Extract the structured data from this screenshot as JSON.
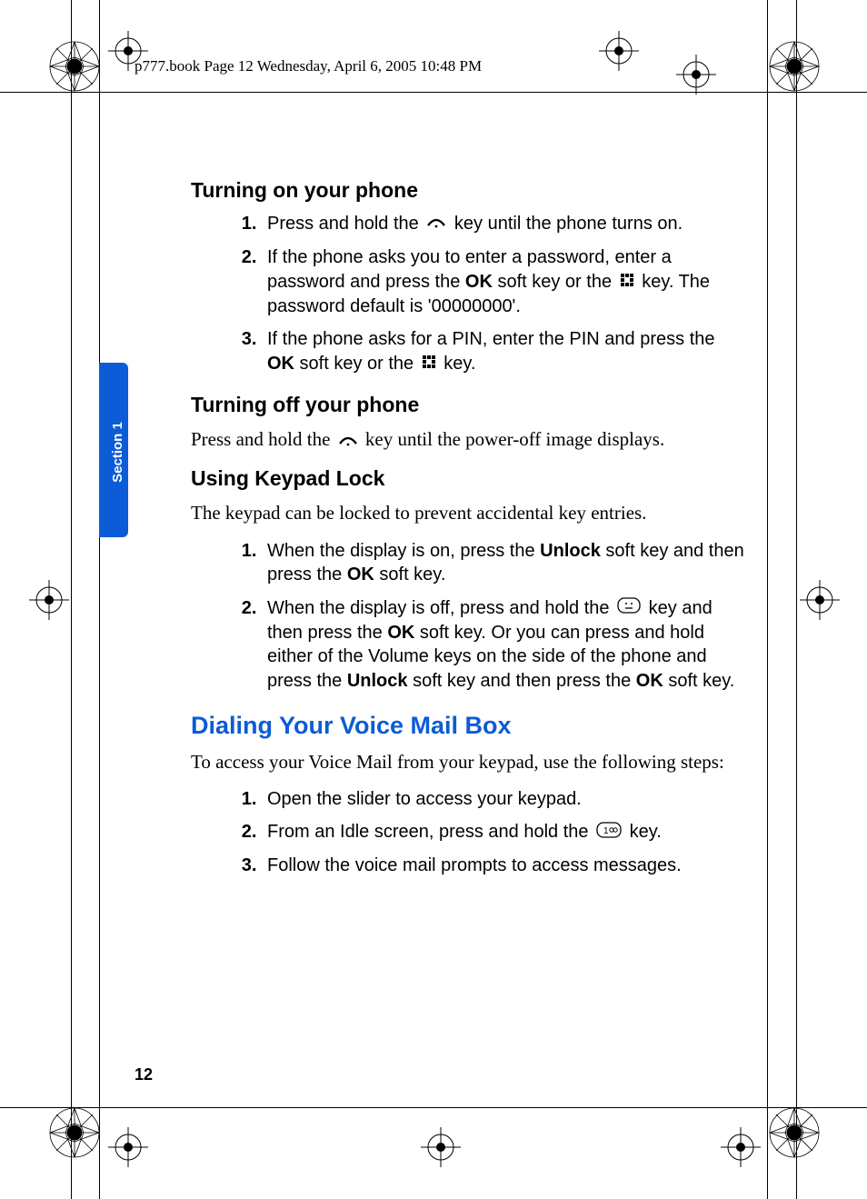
{
  "headerLine": "p777.book  Page 12  Wednesday, April 6, 2005  10:48 PM",
  "sectionTab": "Section 1",
  "pageNumber": "12",
  "headings": {
    "turnOn": "Turning on your phone",
    "turnOff": "Turning off your phone",
    "keypadLock": "Using Keypad Lock",
    "voiceMail": "Dialing Your Voice Mail Box"
  },
  "turnOn": {
    "step1_a": "Press and hold the ",
    "step1_b": " key until the phone turns on.",
    "step2_a": "If the phone asks you to enter a password, enter a password and press the ",
    "step2_b": " soft key or the ",
    "step2_c": " key. The password default is '00000000'.",
    "step3_a": "If the phone asks for a PIN, enter the PIN and press the ",
    "step3_b": " soft key or the ",
    "step3_c": " key.",
    "ok": "OK"
  },
  "turnOffPara_a": "Press and hold the ",
  "turnOffPara_b": " key until the power-off image displays.",
  "keypadLockPara": "The keypad can be locked to prevent accidental key entries.",
  "keypadLock": {
    "step1_a": "When the display is on, press the ",
    "step1_b": " soft key and then press the ",
    "step1_c": " soft key.",
    "unlock": "Unlock",
    "ok": "OK",
    "step2_a": "When the display is off, press and hold the ",
    "step2_b": " key and then press the ",
    "step2_c": " soft key. Or you can press and hold either of the Volume keys on the side of the phone and press the ",
    "step2_d": " soft key and then press the ",
    "step2_e": " soft key."
  },
  "voiceMailPara": "To access your Voice Mail from your keypad, use the following steps:",
  "voiceMail": {
    "step1": "Open the slider to access your keypad.",
    "step2_a": "From an Idle screen, press and hold the ",
    "step2_b": " key.",
    "step3": "Follow the voice mail prompts to access messages."
  }
}
